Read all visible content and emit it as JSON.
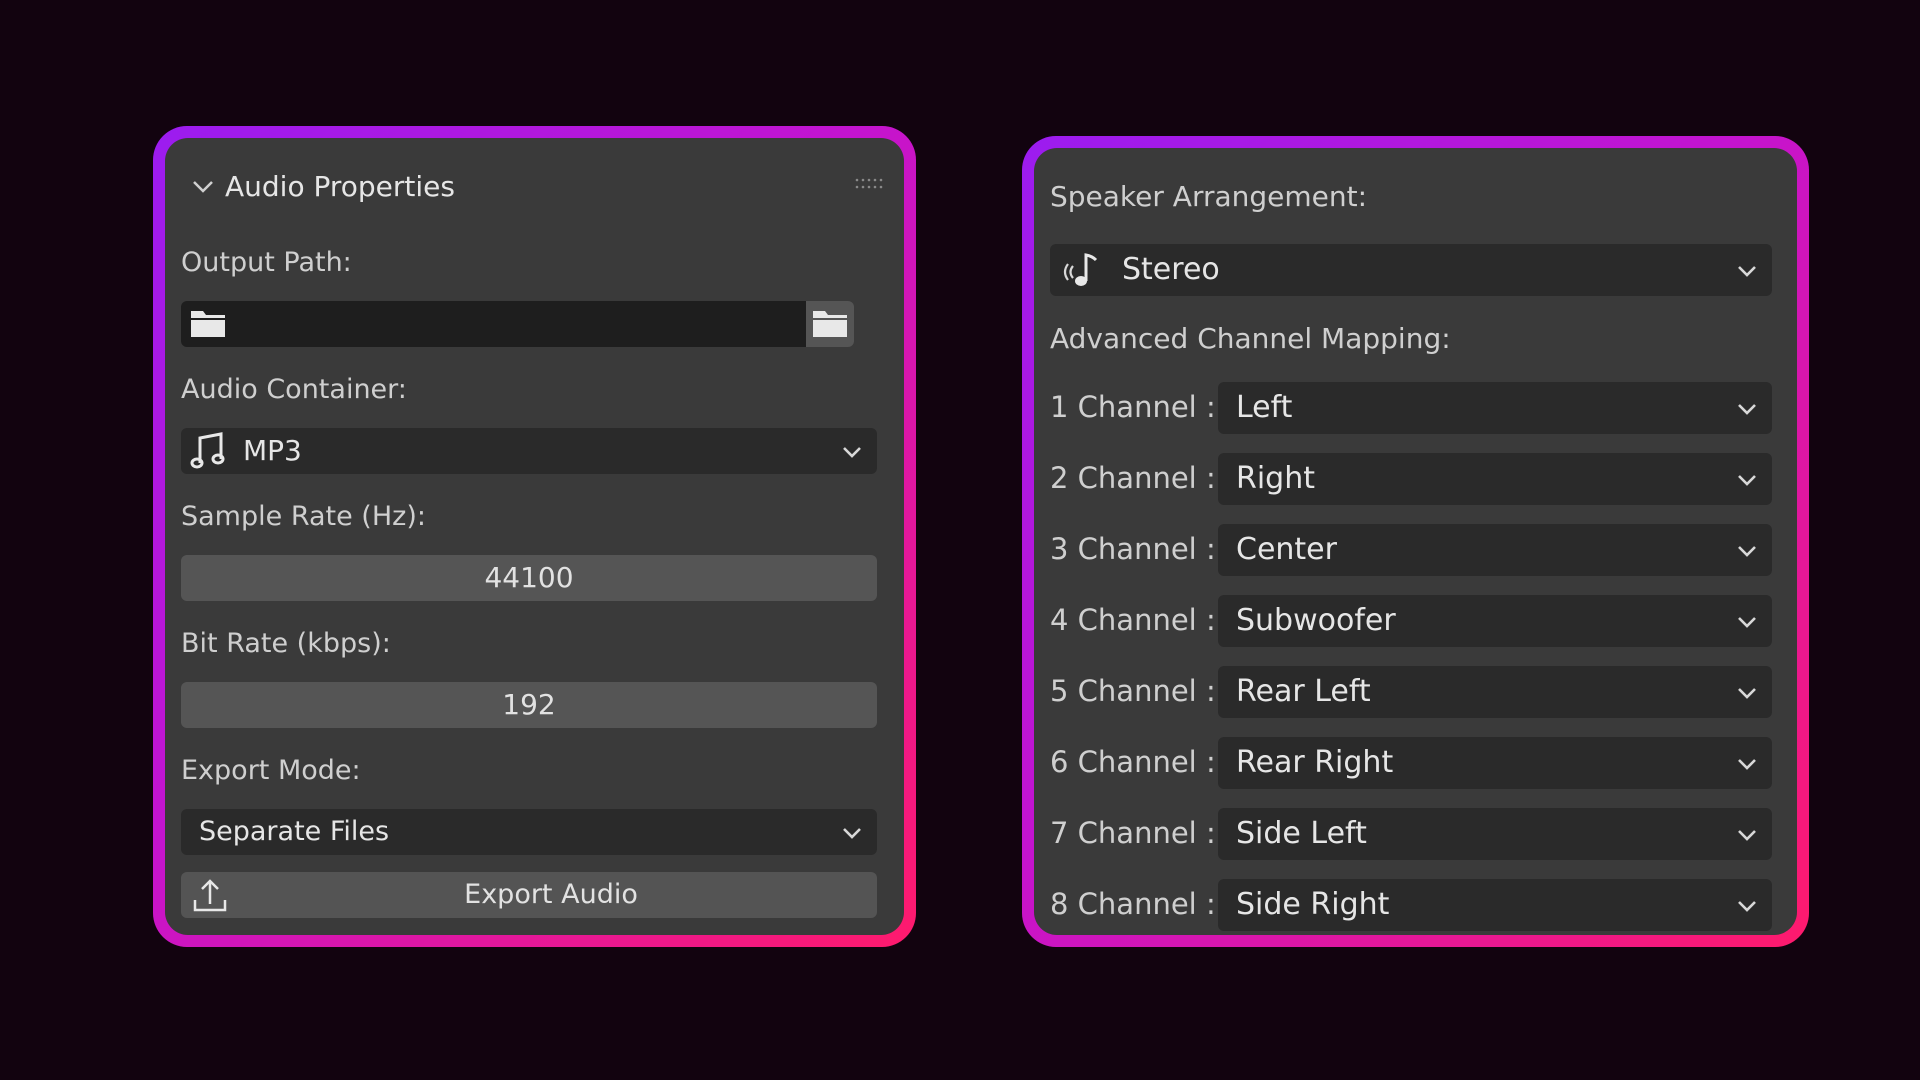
{
  "audio_properties": {
    "title": "Audio Properties",
    "output_path": {
      "label": "Output Path:",
      "value": ""
    },
    "audio_container": {
      "label": "Audio Container:",
      "selected": "MP3",
      "icon": "music-note-icon"
    },
    "sample_rate": {
      "label": "Sample Rate (Hz):",
      "value": "44100"
    },
    "bit_rate": {
      "label": "Bit Rate (kbps):",
      "value": "192"
    },
    "export_mode": {
      "label": "Export Mode:",
      "selected": "Separate Files"
    },
    "export_button": {
      "label": "Export Audio",
      "icon": "upload-icon"
    }
  },
  "speaker_panel": {
    "speaker_arrangement": {
      "label": "Speaker Arrangement:",
      "selected": "Stereo",
      "icon": "speaker-audio-icon"
    },
    "channel_mapping": {
      "title": "Advanced Channel Mapping:",
      "channels": [
        {
          "label": "1 Channel :",
          "value": "Left"
        },
        {
          "label": "2 Channel :",
          "value": "Right"
        },
        {
          "label": "3 Channel :",
          "value": "Center"
        },
        {
          "label": "4 Channel :",
          "value": "Subwoofer"
        },
        {
          "label": "5 Channel :",
          "value": "Rear Left"
        },
        {
          "label": "6 Channel :",
          "value": "Rear Right"
        },
        {
          "label": "7 Channel :",
          "value": "Side Left"
        },
        {
          "label": "8 Channel :",
          "value": "Side Right"
        }
      ]
    }
  },
  "colors": {
    "background": "#12030f",
    "panel": "#3a3a3a",
    "field": "#2b2b2b",
    "accent_start": "#9b1cf0",
    "accent_end": "#ff1a6c"
  }
}
